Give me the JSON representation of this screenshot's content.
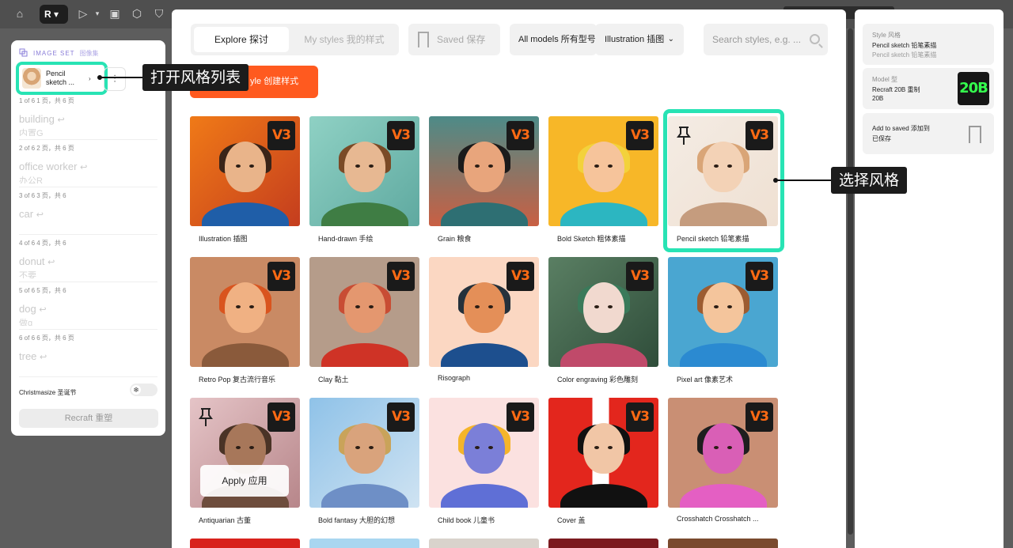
{
  "toolbar": {
    "logo_text": "R"
  },
  "left_panel": {
    "header": "IMAGE SET",
    "header_cn": "图像集",
    "style_chip": "Pencil sketch ...",
    "prompts": [
      {
        "meta": "1 of 6 1 页，共 6 页",
        "text": "building",
        "sub": "内置G"
      },
      {
        "meta": "2 of 6 2 页，共 6 页",
        "text": "office worker",
        "sub": "办公R"
      },
      {
        "meta": "3 of 6 3 页，共 6",
        "text": "car",
        "sub": ""
      },
      {
        "meta": "4 of 6 4 页，共 6",
        "text": "donut",
        "sub": "不要"
      },
      {
        "meta": "5 of 6 5 页，共 6",
        "text": "dog",
        "sub": "做g"
      },
      {
        "meta": "6 of 6 6 页，共 6 页",
        "text": "tree",
        "sub": ""
      }
    ],
    "toggle_label": "Christmasize 圣诞节",
    "recraft_button": "Recraft   重塑"
  },
  "modal": {
    "tab_explore": "Explore 探讨",
    "tab_mystyles": "My styles 我的样式",
    "saved_button": "Saved   保存",
    "models_button": "All models  所有型号",
    "illustration_button": "Illustration   插图",
    "search_placeholder": "Search styles, e.g. ...",
    "create_button": "yle 创建样式",
    "apply_button": "Apply  应用",
    "cards": [
      {
        "label": "Illustration 插图",
        "badge": "V3"
      },
      {
        "label": "Hand-drawn 手绘",
        "badge": "V3"
      },
      {
        "label": "Grain 粮食",
        "badge": "V3"
      },
      {
        "label": "Bold Sketch 粗体素描",
        "badge": "V3"
      },
      {
        "label": "Pencil sketch 铅笔素描",
        "badge": "V3"
      },
      {
        "label": "Retro Pop 复古流行音乐",
        "badge": "V3"
      },
      {
        "label": "Clay 黏土",
        "badge": "V3"
      },
      {
        "label": "Risograph",
        "badge": "V3"
      },
      {
        "label": "Color engraving 彩色雕刻",
        "badge": "V3"
      },
      {
        "label": "Pixel art 像素艺术",
        "badge": "V3"
      },
      {
        "label": "Antiquarian 古董",
        "badge": "V3"
      },
      {
        "label": "Bold fantasy 大胆的幻想",
        "badge": "V3"
      },
      {
        "label": "Child book 儿童书",
        "badge": "V3"
      },
      {
        "label": "Cover 盖",
        "badge": "V3"
      },
      {
        "label": "Crosshatch Crosshatch ...",
        "badge": "V3"
      }
    ]
  },
  "right_panel": {
    "style_caption": "Style 风格",
    "style_value": "Pencil sketch 铅笔素描",
    "style_sub": "Pencil sketch 铅笔素描",
    "model_caption": "Model 型",
    "model_value": "Recraft 20B 重制",
    "model_value2": "20B",
    "model_badge": "20B",
    "saved_text": "Add to saved 添加到",
    "saved_text2": "已保存"
  },
  "annotations": {
    "open_style_list": "打开风格列表",
    "select_style": "选择风格"
  },
  "colors": {
    "accent_teal": "#28e3b4",
    "accent_orange": "#ff5a1f",
    "badge_orange": "#ff6a13",
    "badge_green": "#34ff4d"
  }
}
